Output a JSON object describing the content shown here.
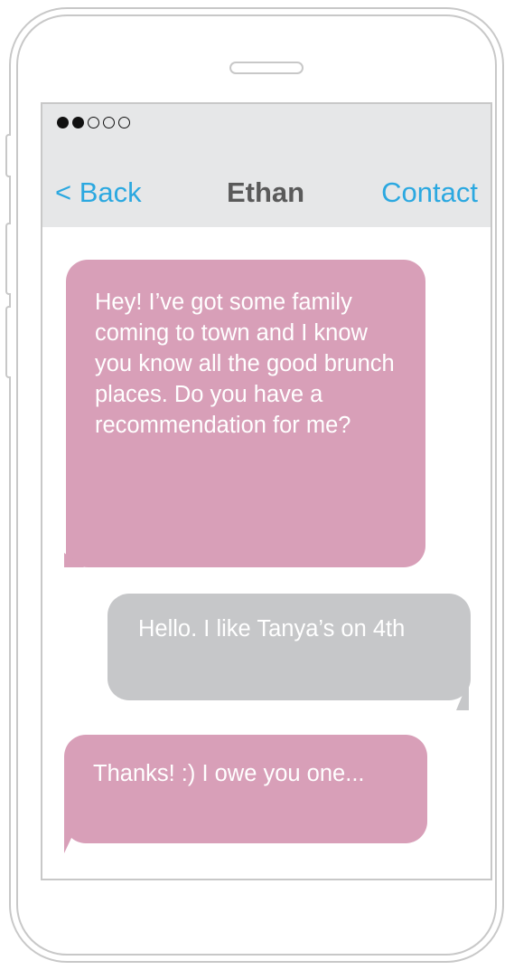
{
  "status_bar": {
    "signal_dots": [
      true,
      true,
      false,
      false,
      false
    ]
  },
  "nav": {
    "back_label": "< Back",
    "title": "Ethan",
    "contact_label": "Contact"
  },
  "messages": [
    {
      "direction": "incoming",
      "text": "Hey! I’ve got some family coming to town and I know you know all the good brunch places. Do you have a recommendation for me?"
    },
    {
      "direction": "outgoing",
      "text": "Hello. I like Tanya’s on 4th"
    },
    {
      "direction": "incoming",
      "text": "Thanks! :) I owe you one..."
    }
  ],
  "colors": {
    "incoming_bubble": "#d89fb8",
    "outgoing_bubble": "#c6c7c9",
    "accent": "#2ba8e0",
    "header_bg": "#e6e7e8"
  }
}
